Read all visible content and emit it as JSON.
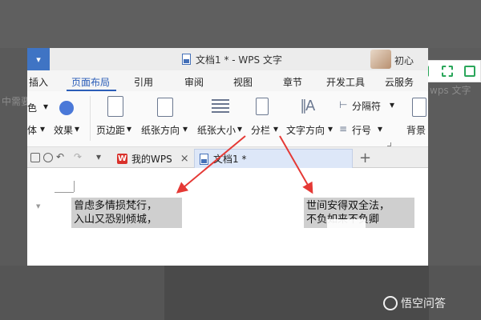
{
  "background": {
    "left_text": "中需要",
    "right_text": "wps 文字",
    "right_text2": "⊡"
  },
  "titlebar": {
    "title": "文档1 * - WPS 文字",
    "user_name": "初心"
  },
  "menu_tabs": [
    "插入",
    "页面布局",
    "引用",
    "审阅",
    "视图",
    "章节",
    "开发工具",
    "云服务"
  ],
  "active_tab": "页面布局",
  "ribbon": {
    "partial_left": [
      "色",
      "体",
      "效果"
    ],
    "margins_label": "页边距",
    "orientation_label": "纸张方向",
    "size_label": "纸张大小",
    "columns_label": "分栏",
    "text_direction_label": "文字方向",
    "separator_label": "分隔符",
    "line_number_label": "行号",
    "background_label": "背景"
  },
  "doc_tabs": {
    "my_wps": "我的WPS",
    "doc1": "文档1 *"
  },
  "document": {
    "left_para": [
      "曾虑多情损梵行，",
      "入山又恐别倾城，"
    ],
    "right_para": [
      "世间安得双全法，",
      "不负如来不负卿"
    ]
  },
  "watermark": {
    "brand": "悟空问答"
  },
  "colors": {
    "accent": "#2b5db8",
    "arrow": "#e53935",
    "tool_green": "#2aa65a"
  }
}
